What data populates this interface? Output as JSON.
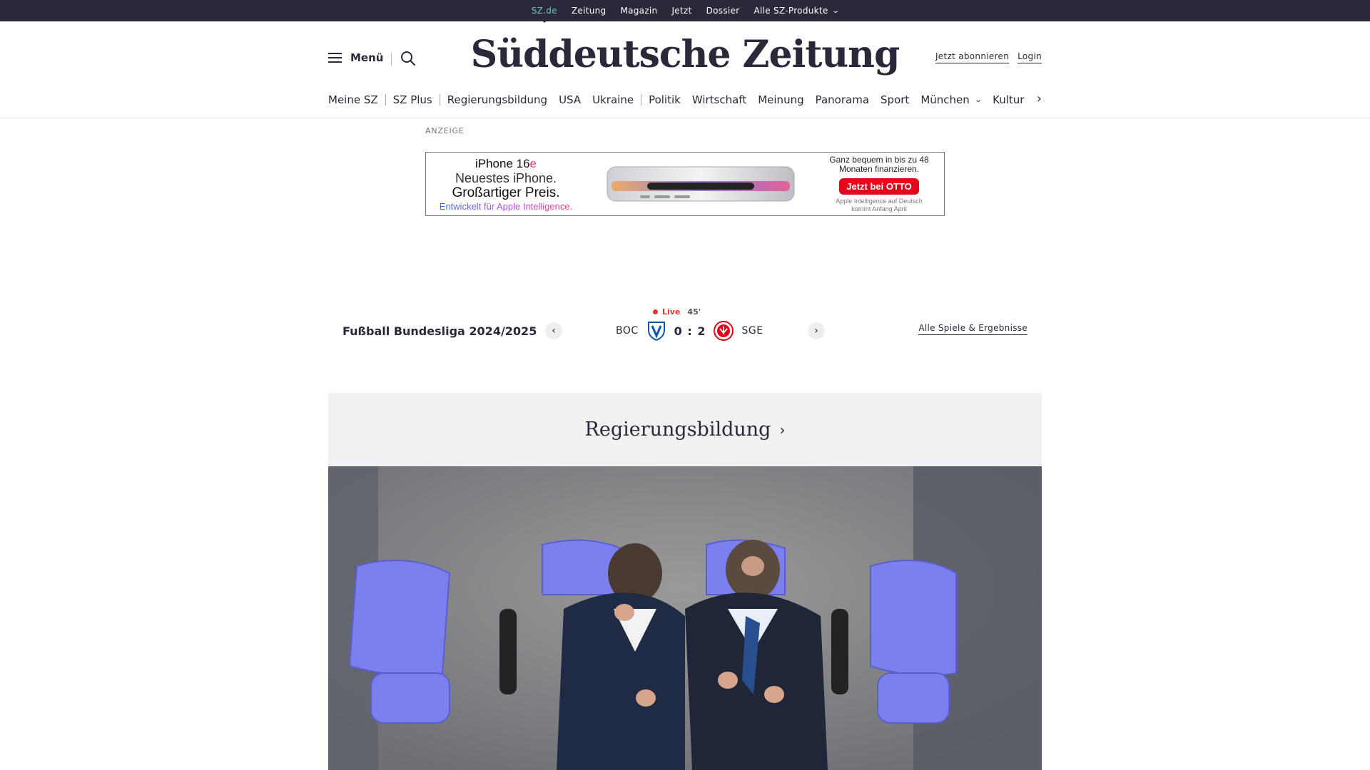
{
  "topbar": {
    "items": [
      {
        "label": "SZ.de",
        "active": true
      },
      {
        "label": "Zeitung"
      },
      {
        "label": "Magazin"
      },
      {
        "label": "Jetzt"
      },
      {
        "label": "Dossier"
      },
      {
        "label": "Alle SZ-Produkte",
        "dropdown": true
      }
    ]
  },
  "header": {
    "menu_label": "Menü",
    "logo": "Süddeutsche Zeitung",
    "subscribe_label": "Jetzt abonnieren",
    "login_label": "Login"
  },
  "nav": {
    "items": [
      "Meine SZ",
      "SZ Plus",
      "Regierungsbildung",
      "USA",
      "Ukraine",
      "Politik",
      "Wirtschaft",
      "Meinung",
      "Panorama",
      "Sport",
      "München",
      "Kultur"
    ]
  },
  "ad": {
    "label": "ANZEIGE",
    "product_prefix": "iPhone 16",
    "product_suffix": "e",
    "line1": "Neuestes iPhone.",
    "line2": "Großartiger Preis.",
    "line3": "Entwickelt für Apple Intelligence.",
    "right_text": "Ganz bequem in bis zu 48 Monaten finanzieren.",
    "cta": "Jetzt bei OTTO",
    "footnote": "Apple Intelligence auf Deutsch kommt Anfang April"
  },
  "ticker": {
    "league": "Fußball Bundesliga 2024/2025",
    "live_label": "Live",
    "minute": "45'",
    "home": "BOC",
    "score": "0 : 2",
    "away": "SGE",
    "all_games_label": "Alle Spiele & Ergebnisse"
  },
  "topic": {
    "title": "Regierungsbildung"
  },
  "colors": {
    "topbar_bg": "#29293a",
    "active_link": "#71c1c9",
    "live_red": "#e3342f",
    "otto_red": "#e3051b",
    "seat_blue": "#7c80ef"
  }
}
